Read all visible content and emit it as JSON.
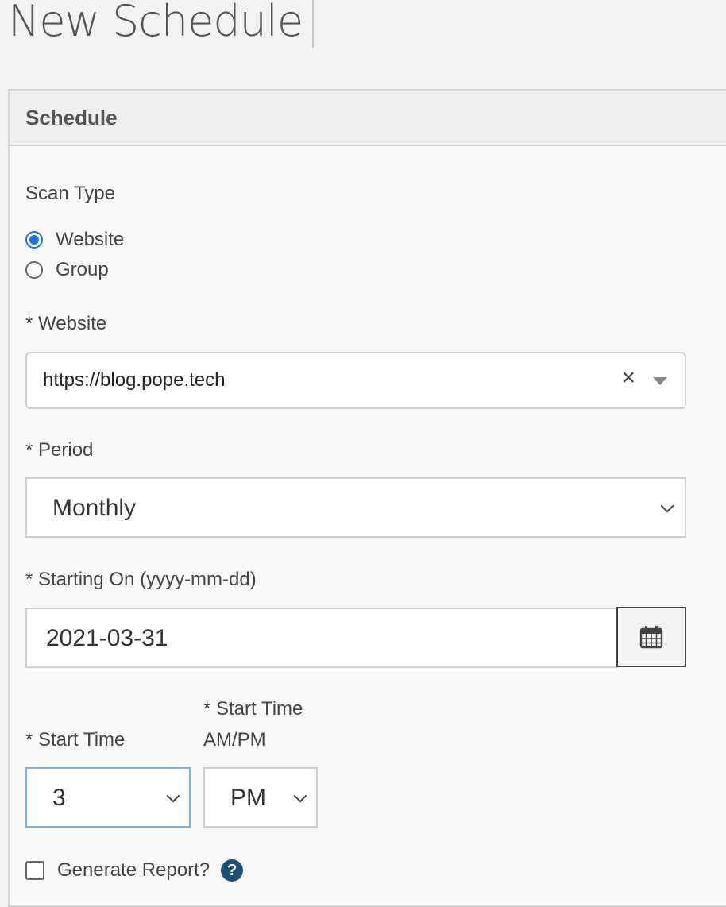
{
  "page": {
    "title": "New Schedule"
  },
  "panel": {
    "title": "Schedule"
  },
  "scan_type": {
    "label": "Scan Type",
    "options": [
      {
        "label": "Website",
        "checked": true
      },
      {
        "label": "Group",
        "checked": false
      }
    ]
  },
  "website": {
    "label": "* Website",
    "value": "https://blog.pope.tech",
    "clear_symbol": "×"
  },
  "period": {
    "label": "* Period",
    "value": "Monthly"
  },
  "starting_on": {
    "label": "* Starting On (yyyy-mm-dd)",
    "value": "2021-03-31",
    "icon": "calendar-icon"
  },
  "start_time": {
    "label": "* Start Time",
    "value": "3"
  },
  "start_time_ampm": {
    "label_line1": "* Start Time",
    "label_line2": "AM/PM",
    "value": "PM"
  },
  "generate_report": {
    "label": "Generate Report?",
    "checked": false,
    "help_symbol": "?"
  },
  "colors": {
    "accent": "#1f73e8",
    "help_icon": "#1f4e79",
    "focus_border": "#7ab7ee"
  }
}
